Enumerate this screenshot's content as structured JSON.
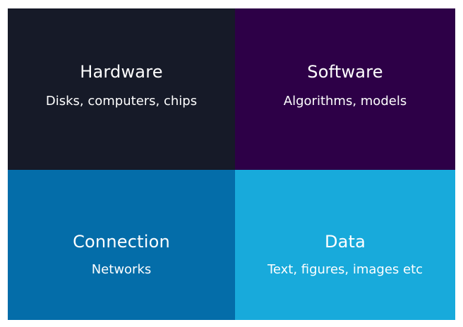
{
  "quadrants": [
    {
      "title": "Hardware",
      "subtitle": "Disks, computers, chips",
      "color": "#161a28"
    },
    {
      "title": "Software",
      "subtitle": "Algorithms, models",
      "color": "#2d0047"
    },
    {
      "title": "Connection",
      "subtitle": "Networks",
      "color": "#046da9"
    },
    {
      "title": "Data",
      "subtitle": "Text, figures, images etc",
      "color": "#18aadb"
    }
  ]
}
